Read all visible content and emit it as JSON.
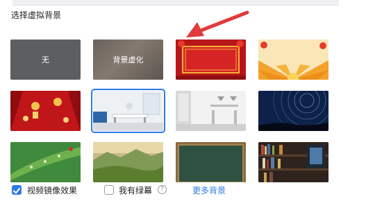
{
  "panel": {
    "section_title": "选择虚拟背景"
  },
  "backgrounds": [
    {
      "label": "无",
      "kind": "none"
    },
    {
      "label": "背景虚化",
      "kind": "blur"
    },
    {
      "label": "",
      "kind": "chinese-red-frame"
    },
    {
      "label": "",
      "kind": "festive-sunburst"
    },
    {
      "label": "",
      "kind": "red-curtains-lanterns"
    },
    {
      "label": "",
      "kind": "living-room",
      "selected": true
    },
    {
      "label": "",
      "kind": "white-office"
    },
    {
      "label": "",
      "kind": "star-trails"
    },
    {
      "label": "",
      "kind": "green-leaf-droplets"
    },
    {
      "label": "",
      "kind": "mountain-landscape"
    },
    {
      "label": "",
      "kind": "chalkboard"
    },
    {
      "label": "",
      "kind": "bookshelf"
    }
  ],
  "footer": {
    "mirror_label": "视频镜像效果",
    "mirror_checked": true,
    "greenscreen_label": "我有绿幕",
    "greenscreen_checked": false,
    "help_glyph": "?",
    "more_label": "更多背景"
  },
  "colors": {
    "accent": "#2d7be5",
    "arrow": "#e03a3a"
  }
}
